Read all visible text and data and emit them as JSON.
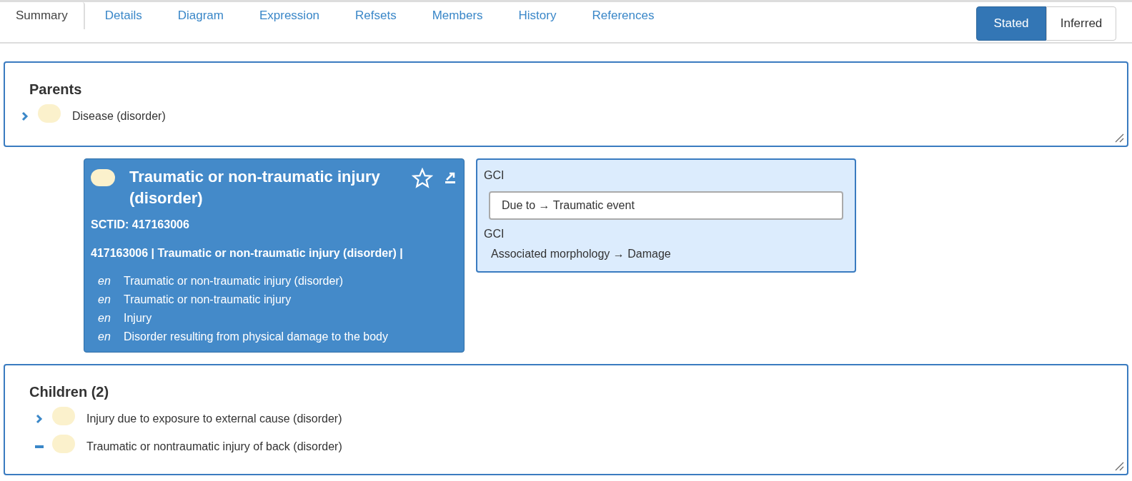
{
  "tabs": [
    {
      "label": "Summary",
      "selected": true
    },
    {
      "label": "Details",
      "selected": false
    },
    {
      "label": "Diagram",
      "selected": false
    },
    {
      "label": "Expression",
      "selected": false
    },
    {
      "label": "Refsets",
      "selected": false
    },
    {
      "label": "Members",
      "selected": false
    },
    {
      "label": "History",
      "selected": false
    },
    {
      "label": "References",
      "selected": false
    }
  ],
  "view_toggle": [
    {
      "label": "Stated",
      "selected": true
    },
    {
      "label": "Inferred",
      "selected": false
    }
  ],
  "parents": {
    "title": "Parents",
    "items": [
      {
        "label": "Disease (disorder)",
        "kind": "expandable"
      }
    ]
  },
  "concept": {
    "title": "Traumatic or non-traumatic injury (disorder)",
    "sctid": "SCTID: 417163006",
    "expression": "417163006 | Traumatic or non-traumatic injury (disorder) |",
    "descriptions": [
      {
        "lang": "en",
        "term": "Traumatic or non-traumatic injury (disorder)"
      },
      {
        "lang": "en",
        "term": "Traumatic or non-traumatic injury"
      },
      {
        "lang": "en",
        "term": "Injury"
      },
      {
        "lang": "en",
        "term": "Disorder resulting from physical damage to the body"
      }
    ]
  },
  "gci": [
    {
      "label": "GCI",
      "kind": "group",
      "relation": "Due to →  Traumatic event"
    },
    {
      "label": "GCI",
      "kind": "plain",
      "relation": "Associated morphology →  Damage"
    }
  ],
  "children": {
    "title": "Children (2)",
    "items": [
      {
        "label": "Injury due to exposure to external cause (disorder)",
        "kind": "expandable"
      },
      {
        "label": "Traumatic or nontraumatic injury of back (disorder)",
        "kind": "leaf"
      }
    ]
  }
}
